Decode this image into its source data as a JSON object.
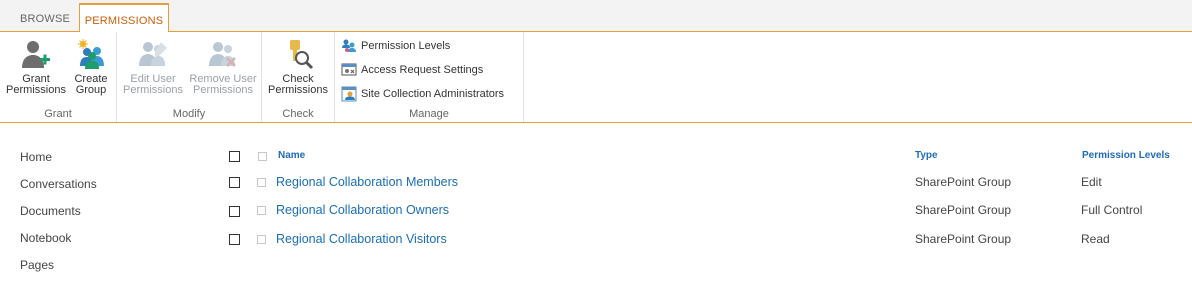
{
  "tabs": {
    "browse": "BROWSE",
    "permissions": "PERMISSIONS"
  },
  "ribbon": {
    "grant": {
      "label": "Grant",
      "grant_permissions": [
        "Grant",
        "Permissions"
      ],
      "create_group": [
        "Create",
        "Group"
      ]
    },
    "modify": {
      "label": "Modify",
      "edit_user_permissions": [
        "Edit User",
        "Permissions"
      ],
      "remove_user_permissions": [
        "Remove User",
        "Permissions"
      ]
    },
    "check": {
      "label": "Check",
      "check_permissions": [
        "Check",
        "Permissions"
      ]
    },
    "manage": {
      "label": "Manage",
      "permission_levels": "Permission Levels",
      "access_request_settings": "Access Request Settings",
      "site_collection_administrators": "Site Collection Administrators"
    }
  },
  "leftnav": [
    "Home",
    "Conversations",
    "Documents",
    "Notebook",
    "Pages"
  ],
  "list": {
    "columns": {
      "name": "Name",
      "type": "Type",
      "levels": "Permission Levels"
    },
    "rows": [
      {
        "name": "Regional Collaboration Members",
        "type": "SharePoint Group",
        "level": "Edit"
      },
      {
        "name": "Regional Collaboration Owners",
        "type": "SharePoint Group",
        "level": "Full Control"
      },
      {
        "name": "Regional Collaboration Visitors",
        "type": "SharePoint Group",
        "level": "Read"
      }
    ]
  },
  "colors": {
    "accent": "#e39f3c",
    "tab_text": "#c95f0a",
    "link": "#1a6eb4"
  },
  "icons": [
    "grant-permissions-icon",
    "create-group-icon",
    "edit-user-permissions-icon",
    "remove-user-permissions-icon",
    "check-permissions-icon",
    "permission-levels-icon",
    "access-request-settings-icon",
    "site-collection-administrators-icon"
  ]
}
